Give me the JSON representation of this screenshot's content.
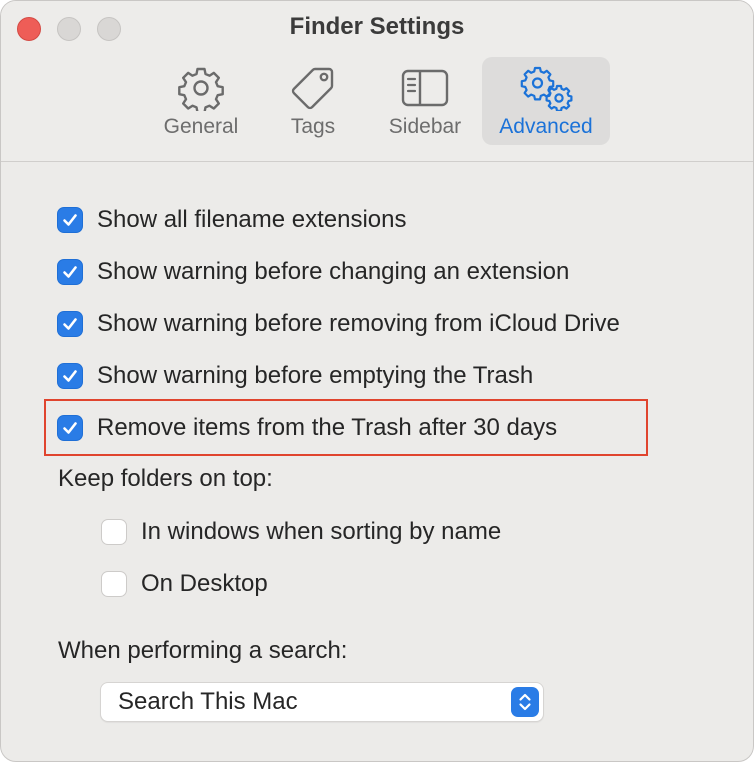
{
  "window": {
    "title": "Finder Settings"
  },
  "tabs": [
    {
      "label": "General",
      "icon": "gear-icon"
    },
    {
      "label": "Tags",
      "icon": "tag-icon"
    },
    {
      "label": "Sidebar",
      "icon": "sidebar-icon"
    },
    {
      "label": "Advanced",
      "icon": "gears-icon",
      "active": true
    }
  ],
  "options": [
    {
      "label": "Show all filename extensions",
      "checked": true
    },
    {
      "label": "Show warning before changing an extension",
      "checked": true
    },
    {
      "label": "Show warning before removing from iCloud Drive",
      "checked": true
    },
    {
      "label": "Show warning before emptying the Trash",
      "checked": true
    },
    {
      "label": "Remove items from the Trash after 30 days",
      "checked": true
    }
  ],
  "folders_section": {
    "label": "Keep folders on top:",
    "options": [
      {
        "label": "In windows when sorting by name",
        "checked": false
      },
      {
        "label": "On Desktop",
        "checked": false
      }
    ]
  },
  "search_section": {
    "label": "When performing a search:",
    "selected": "Search This Mac"
  },
  "colors": {
    "accent": "#2a7ce6",
    "highlight": "#e0442e",
    "close_button": "#ee5d57"
  }
}
